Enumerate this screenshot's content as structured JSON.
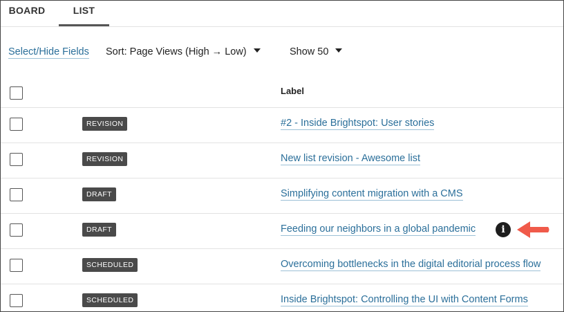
{
  "tabs": [
    {
      "label": "BOARD"
    },
    {
      "label": "LIST"
    }
  ],
  "toolbar": {
    "select_hide_fields": "Select/Hide Fields",
    "sort_label": "Sort: Page Views (High → Low)",
    "show_label": "Show 50"
  },
  "table": {
    "columns": {
      "label": "Label"
    },
    "rows": [
      {
        "status": "REVISION",
        "title": "#2 - Inside Brightspot: User stories"
      },
      {
        "status": "REVISION",
        "title": "New list revision - Awesome list"
      },
      {
        "status": "DRAFT",
        "title": "Simplifying content migration with a CMS"
      },
      {
        "status": "DRAFT",
        "title": "Feeding our neighbors in a global pandemic",
        "info_icon": "i"
      },
      {
        "status": "SCHEDULED",
        "title": "Overcoming bottlenecks in the digital editorial process flow"
      },
      {
        "status": "SCHEDULED",
        "title": "Inside Brightspot: Controlling the UI with Content Forms"
      }
    ]
  },
  "colors": {
    "link": "#2b6f9a",
    "badge_bg": "#4a4a4a",
    "arrow": "#f05a4a"
  }
}
